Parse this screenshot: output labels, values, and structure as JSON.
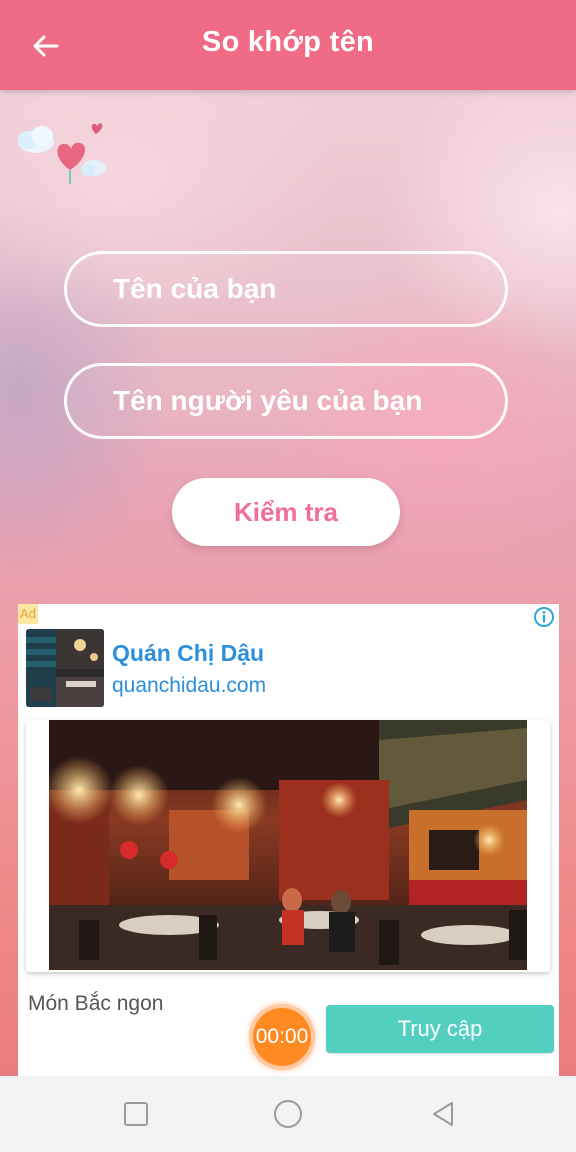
{
  "header": {
    "title": "So khớp tên",
    "back_icon": "arrow-left-icon"
  },
  "form": {
    "your_name_placeholder": "Tên của bạn",
    "lover_name_placeholder": "Tên người yêu của bạn",
    "check_label": "Kiểm tra"
  },
  "ad": {
    "badge": "Ad",
    "headline": "Quán Chị Dậu",
    "url": "quanchidau.com",
    "body": "Món Bắc ngon",
    "cta": "Truy cập"
  },
  "timer": {
    "value": "00:00"
  },
  "colors": {
    "header": "#f06b85",
    "check_text": "#f06f96",
    "ad_link": "#2c8fdb",
    "cta": "#53cfc1",
    "timer": "#ff8a22"
  },
  "nav": {
    "icons": [
      "recents-square-icon",
      "home-circle-icon",
      "back-triangle-icon"
    ]
  }
}
